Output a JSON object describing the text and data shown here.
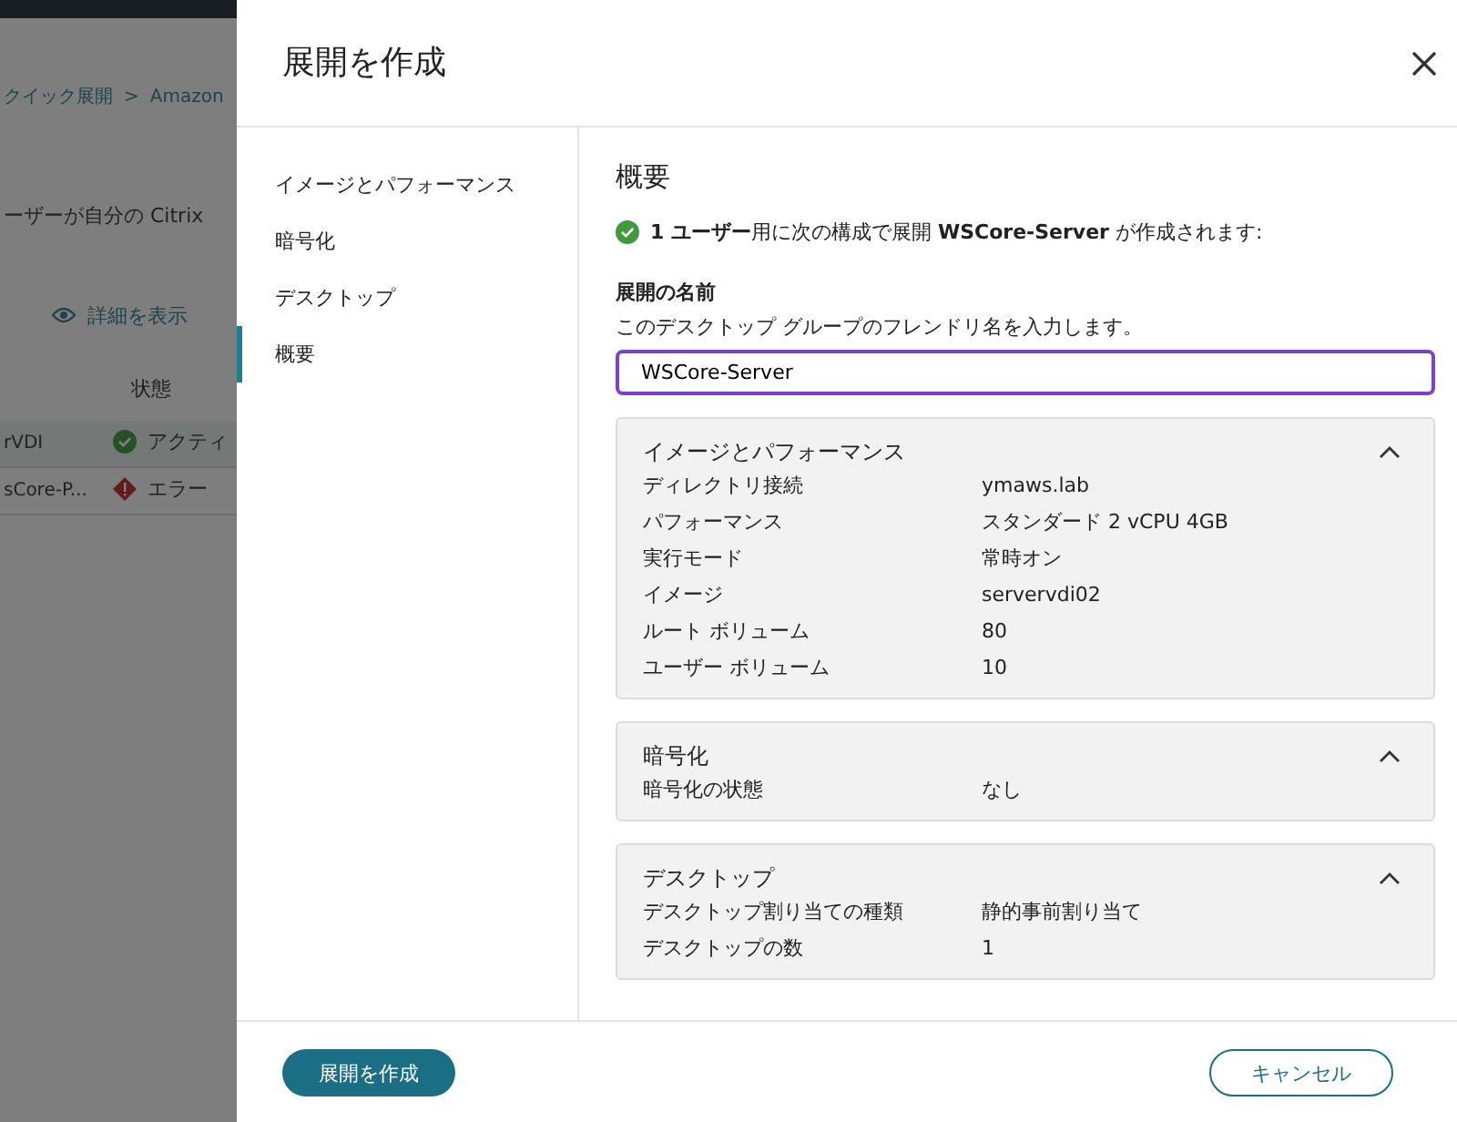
{
  "background": {
    "breadcrumb": [
      "クイック展開",
      "Amazon"
    ],
    "separator": ">",
    "description": "ーザーが自分の Citrix",
    "toolbar": [
      {
        "label": "詳細を表示"
      }
    ],
    "column": "状態",
    "rows": [
      {
        "name": "rVDI",
        "status": "アクティ",
        "kind": "ok"
      },
      {
        "name": "sCore-P...",
        "status": "エラー",
        "kind": "error"
      }
    ]
  },
  "drawer": {
    "title": "展開を作成",
    "nav": [
      {
        "label": "イメージとパフォーマンス",
        "selected": false
      },
      {
        "label": "暗号化",
        "selected": false
      },
      {
        "label": "デスクトップ",
        "selected": false
      },
      {
        "label": "概要",
        "selected": true
      }
    ],
    "heading": "概要",
    "message": "**1 ユーザー**用に次の構成で展開 **WSCore-Server** が作成されます:",
    "field": {
      "label": "展開の名前",
      "hint": "このデスクトップ グループのフレンドリ名を入力します。",
      "value": "WSCore-Server"
    },
    "sections": [
      {
        "title": "イメージとパフォーマンス",
        "expanded": true,
        "rows": [
          {
            "label": "ディレクトリ接続",
            "value": "ymaws.lab"
          },
          {
            "label": "パフォーマンス",
            "value": "スタンダード 2 vCPU 4GB"
          },
          {
            "label": "実行モード",
            "value": "常時オン"
          },
          {
            "label": "イメージ",
            "value": "servervdi02"
          },
          {
            "label": "ルート ボリューム",
            "value": "80"
          },
          {
            "label": "ユーザー ボリューム",
            "value": "10"
          }
        ]
      },
      {
        "title": "暗号化",
        "expanded": true,
        "rows": [
          {
            "label": "暗号化の状態",
            "value": "なし"
          }
        ]
      },
      {
        "title": "デスクトップ",
        "expanded": true,
        "rows": [
          {
            "label": "デスクトップ割り当ての種類",
            "value": "静的事前割り当て"
          },
          {
            "label": "デスクトップの数",
            "value": "1"
          }
        ]
      }
    ],
    "buttons": [
      {
        "label": "展開を作成",
        "kind": "primary"
      },
      {
        "label": "キャンセル",
        "kind": "secondary"
      }
    ]
  }
}
